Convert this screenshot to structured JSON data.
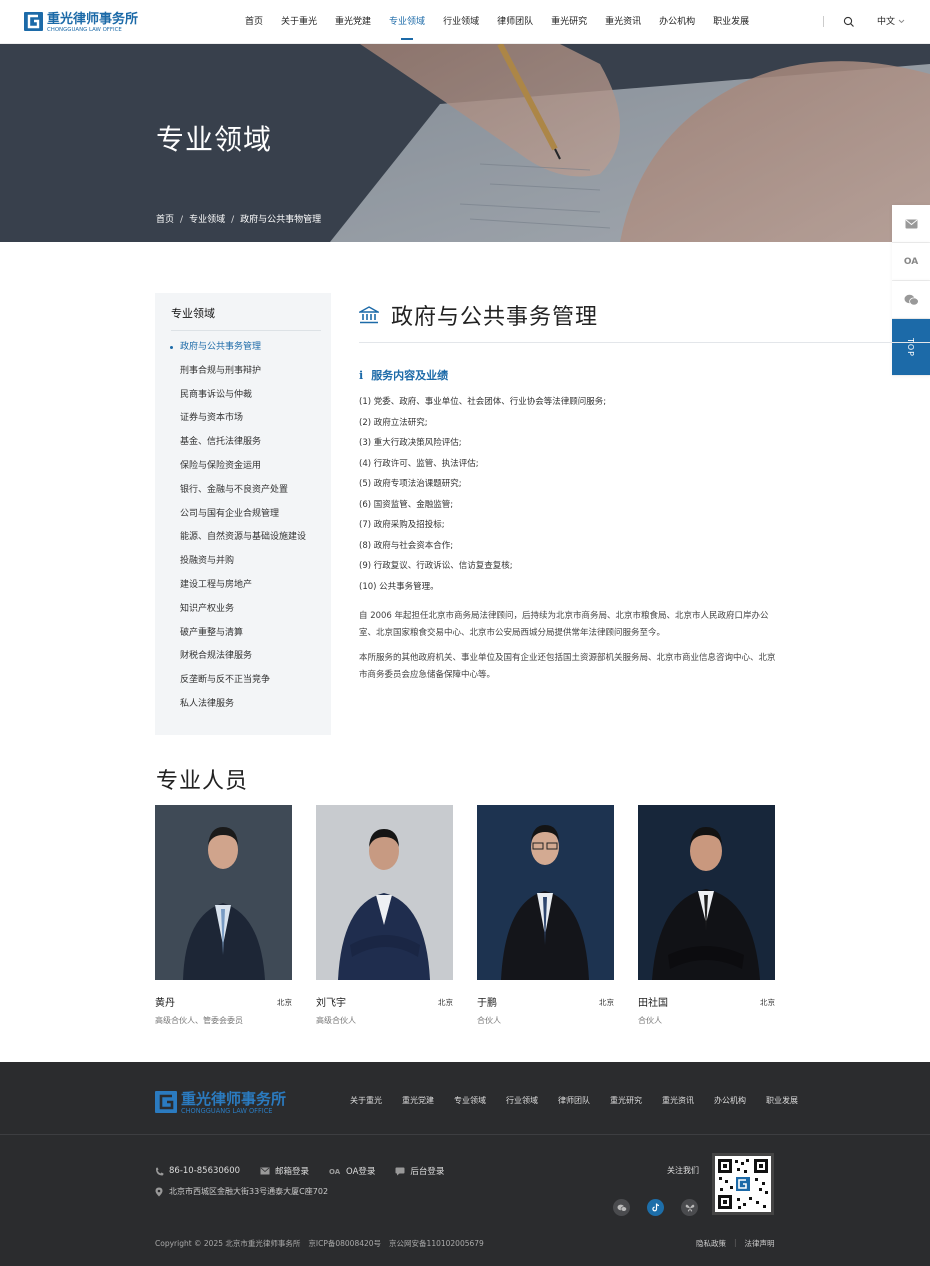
{
  "header": {
    "logo_cn": "重光律师事务所",
    "logo_en": "CHONGGUANG LAW OFFICE",
    "nav": [
      "首页",
      "关于重光",
      "重光党建",
      "专业领域",
      "行业领域",
      "律师团队",
      "重光研究",
      "重光资讯",
      "办公机构",
      "职业发展"
    ],
    "active_nav": "专业领域",
    "lang": "中文"
  },
  "banner": {
    "title": "专业领域",
    "breadcrumb": [
      "首页",
      "专业领域",
      "政府与公共事物管理"
    ]
  },
  "float_bar": {
    "top_label": "TOP",
    "oa_label": "OA"
  },
  "left_menu": {
    "title": "专业领域",
    "items": [
      "政府与公共事务管理",
      "刑事合规与刑事辩护",
      "民商事诉讼与仲裁",
      "证券与资本市场",
      "基金、信托法律服务",
      "保险与保险资金运用",
      "银行、金融与不良资产处置",
      "公司与国有企业合规管理",
      "能源、自然资源与基础设施建设",
      "投融资与并购",
      "建设工程与房地产",
      "知识产权业务",
      "破产重整与清算",
      "财税合规法律服务",
      "反垄断与反不正当竞争",
      "私人法律服务"
    ],
    "active_index": 0
  },
  "main": {
    "title": "政府与公共事务管理",
    "section_icon_char": "i",
    "section_title": "服务内容及业绩",
    "services": [
      "(1) 党委、政府、事业单位、社会团体、行业协会等法律顾问服务;",
      "(2) 政府立法研究;",
      "(3) 重大行政决策风险评估;",
      "(4) 行政许可、监管、执法评估;",
      "(5) 政府专项法治课题研究;",
      "(6) 国资监管、金融监管;",
      "(7) 政府采购及招投标;",
      "(8) 政府与社会资本合作;",
      "(9) 行政复议、行政诉讼、信访复查复核;",
      "(10) 公共事务管理。"
    ],
    "paragraph_1": "自 2006 年起担任北京市商务局法律顾问，后持续为北京市商务局、北京市粮食局、北京市人民政府口岸办公室、北京国家粮食交易中心、北京市公安局西城分局提供常年法律顾问服务至今。",
    "paragraph_2": "本所服务的其他政府机关、事业单位及国有企业还包括国土资源部机关服务局、北京市商业信息咨询中心、北京市商务委员会应急储备保障中心等。"
  },
  "professionals": {
    "title": "专业人员",
    "people": [
      {
        "name": "黄丹",
        "city": "北京",
        "role": "高级合伙人、管委会委员"
      },
      {
        "name": "刘飞宇",
        "city": "北京",
        "role": "高级合伙人"
      },
      {
        "name": "于鹏",
        "city": "北京",
        "role": "合伙人"
      },
      {
        "name": "田社国",
        "city": "北京",
        "role": "合伙人"
      }
    ]
  },
  "footer": {
    "logo_cn": "重光律师事务所",
    "logo_en": "CHONGGUANG LAW OFFICE",
    "nav": [
      "关于重光",
      "重光党建",
      "专业领域",
      "行业领域",
      "律师团队",
      "重光研究",
      "重光资讯",
      "办公机构",
      "职业发展"
    ],
    "phone": "86-10-85630600",
    "mail_login": "邮箱登录",
    "oa_login": "OA登录",
    "admin_login": "后台登录",
    "address": "北京市西城区金融大街33号通泰大厦C座702",
    "follow": "关注我们",
    "copyright": "Copyright © 2025 北京市重光律师事务所",
    "icp": "京ICP备08008420号",
    "police": "京公网安备110102005679",
    "privacy": "隐私政策",
    "legal": "法律声明"
  },
  "colors": {
    "brand": "#1c6aa8",
    "footer_bg": "#2b2c2e",
    "menu_bg": "#f3f5f7"
  }
}
